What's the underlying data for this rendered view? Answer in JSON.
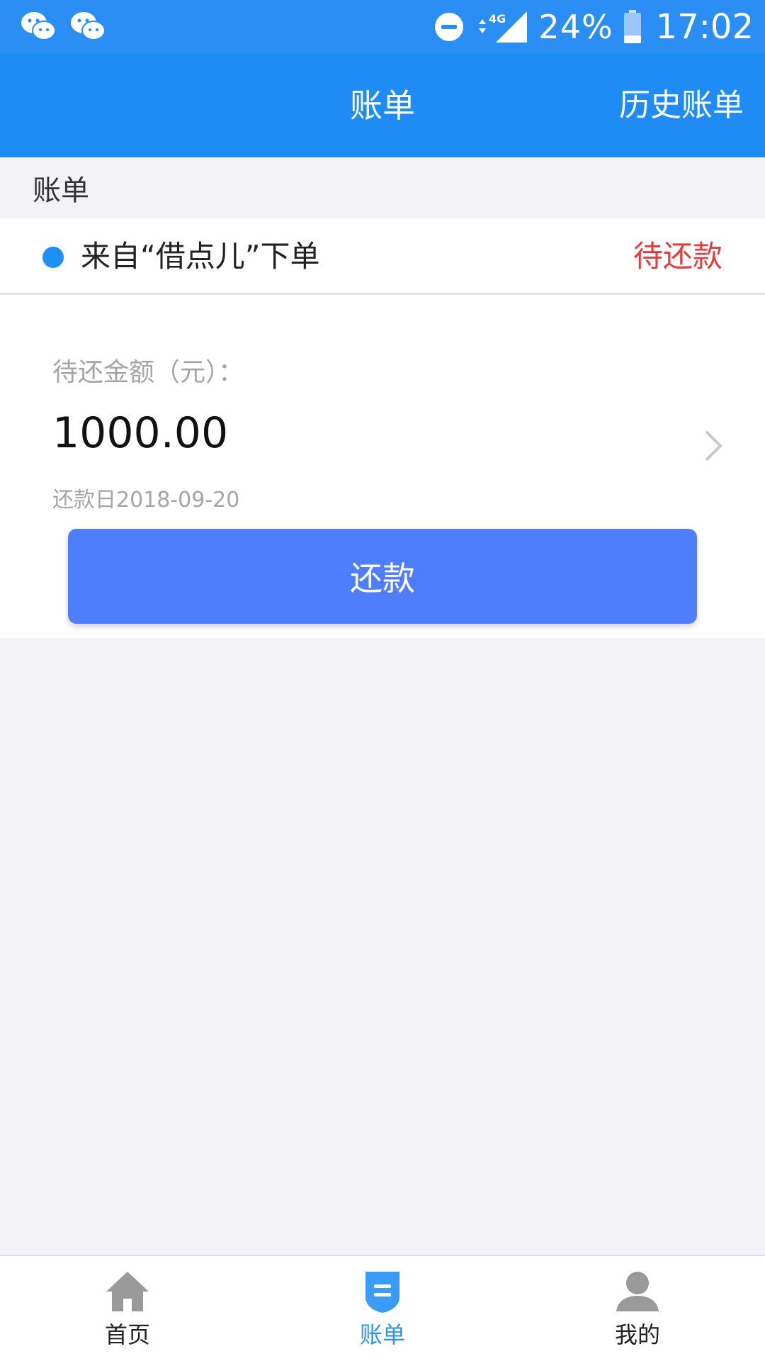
{
  "status_bar": {
    "battery_percent": "24%",
    "time": "17:02",
    "network": "4G",
    "left_icons": [
      "wechat-icon",
      "wechat-icon"
    ],
    "right_icons": [
      "do-not-disturb-icon",
      "signal-icon",
      "battery-icon"
    ]
  },
  "header": {
    "title": "账单",
    "history_label": "历史账单"
  },
  "section": {
    "label": "账单"
  },
  "bill": {
    "source": "来自“借点儿”下单",
    "status": "待还款",
    "amount_label": "待还金额（元）：",
    "amount": "1000.00",
    "due_date": "还款日2018-09-20",
    "repay_button": "还款"
  },
  "tabs": [
    {
      "label": "首页",
      "icon": "home-icon",
      "active": false
    },
    {
      "label": "账单",
      "icon": "bill-icon",
      "active": true
    },
    {
      "label": "我的",
      "icon": "user-icon",
      "active": false
    }
  ],
  "colors": {
    "header_bg": "#1e8cf4",
    "status_red": "#e63b3b",
    "button_bg": "#4f7efc",
    "active_tab": "#2b92f5",
    "dot_blue": "#1f8ff5"
  }
}
